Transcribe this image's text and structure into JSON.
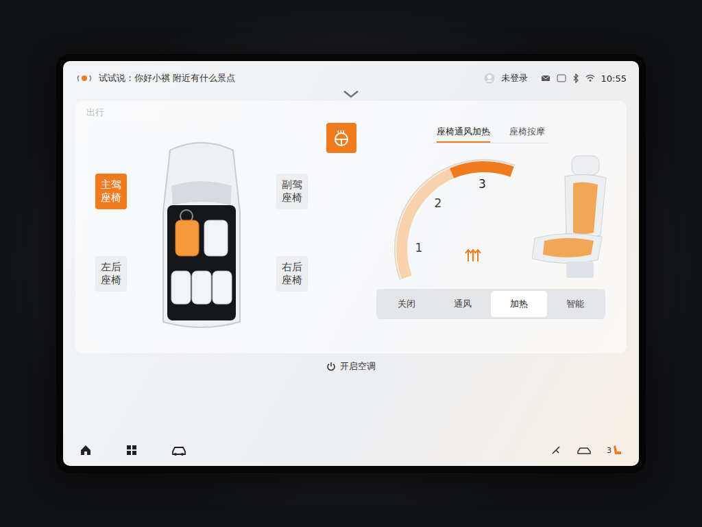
{
  "top_bar": {
    "voice_hint": "试试说：你好小祺 附近有什么景点",
    "account": "未登录",
    "time": "10:55"
  },
  "section_label": "出行",
  "seats": [
    {
      "label": "主驾座椅",
      "selected": true
    },
    {
      "label": "副驾座椅",
      "selected": false
    },
    {
      "label": "左后座椅",
      "selected": false
    },
    {
      "label": "右后座椅",
      "selected": false
    }
  ],
  "steering_wheel_heat": {
    "on": true
  },
  "tabs": [
    {
      "label": "座椅通风加热",
      "selected": true
    },
    {
      "label": "座椅按摩",
      "selected": false
    }
  ],
  "heat_levels": [
    {
      "label": "1",
      "selected": false
    },
    {
      "label": "2",
      "selected": false
    },
    {
      "label": "3",
      "selected": true
    }
  ],
  "modes": [
    {
      "label": "关闭",
      "selected": false
    },
    {
      "label": "通风",
      "selected": false
    },
    {
      "label": "加热",
      "selected": true
    },
    {
      "label": "智能",
      "selected": false
    }
  ],
  "ac_button": "开启空调",
  "status_indicator": "3"
}
